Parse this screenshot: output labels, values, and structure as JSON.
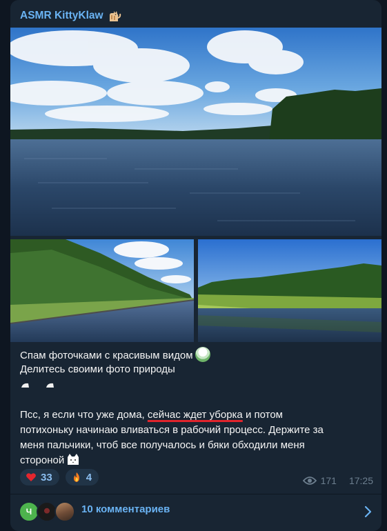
{
  "channel": {
    "name": "ASMR KittyKlaw"
  },
  "photos": [
    {
      "name": "river-panorama"
    },
    {
      "name": "river-forest-bank"
    },
    {
      "name": "river-meadow"
    }
  ],
  "message": {
    "line1": "Спам фоточками с красивым видом",
    "line2": "Делитесь своими фото природы",
    "para2_line1_a": "Псс, я если что уже дома, ",
    "para2_line1_u": "сейчас ждет уборка",
    "para2_line1_b": " и потом",
    "para2_line2": "потихоньку начинаю вливаться в рабочий процесс. Держите за",
    "para2_line3": "меня пальчики,  чтоб все получалось и бяки обходили меня",
    "para2_line4": "стороной"
  },
  "reactions": [
    {
      "icon": "heart-icon",
      "count": "33"
    },
    {
      "icon": "fire-icon",
      "count": "4"
    }
  ],
  "meta": {
    "views": "171",
    "time": "17:25"
  },
  "comments": {
    "label": "10 комментариев",
    "avatar1_letter": "Ч"
  }
}
